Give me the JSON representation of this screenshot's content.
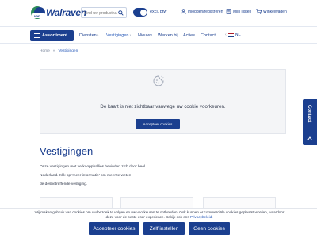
{
  "header": {
    "logo_text": "Walraven",
    "logo_badge": "van",
    "search": {
      "placeholder": "Vind uw productnaam"
    },
    "vat_toggle": {
      "label": "excl. btw",
      "on": true
    },
    "utilities": [
      {
        "icon": "user-icon",
        "label": "Inloggen/registreren"
      },
      {
        "icon": "list-icon",
        "label": "Mijn lijsten"
      },
      {
        "icon": "cart-icon",
        "label": "Winkelwagen"
      }
    ]
  },
  "nav": {
    "assortment_label": "Assortiment",
    "items": [
      {
        "label": "Diensten",
        "has_chevron": true
      },
      {
        "label": "Vestigingen",
        "has_chevron": true,
        "active": true
      },
      {
        "label": "Nieuws"
      },
      {
        "label": "Werken bij"
      },
      {
        "label": "Acties"
      },
      {
        "label": "Contact"
      }
    ],
    "language": "NL"
  },
  "breadcrumb": {
    "home": "Home",
    "separator": "»",
    "current": "Vestigingen"
  },
  "map_placeholder": {
    "message": "De kaart is niet zichtbaar vanwege uw cookie voorkeuren.",
    "accept_label": "Accepteer cookies"
  },
  "contact_tab": {
    "label": "Contact"
  },
  "page": {
    "title": "Vestigingen",
    "intro_lines": [
      "Onze vestigingen met verkooppballies bevinden zich door heel",
      "Nederland. Klik op 'meer informatie' om meer te weten te komen over",
      "de desbetreffende vestiging."
    ]
  },
  "cookie_bar": {
    "message_line1": "Wij maken gebruik van cookies om uw bezoek te volgen en uw voorkeuren te onthouden. Ook kunnen er commerciële cookies geplaatst worden, waardoor",
    "message_line2_pre": "deze voor de beste user experience. Bekijk ook ons ",
    "message_link": "Privacybeleid",
    "message_line2_post": ".",
    "accept_label": "Accepteer cookies",
    "settings_label": "Zelf instellen",
    "reject_label": "Geen cookies"
  },
  "colors": {
    "brand": "#1b3f8f",
    "link": "#2457b8"
  }
}
